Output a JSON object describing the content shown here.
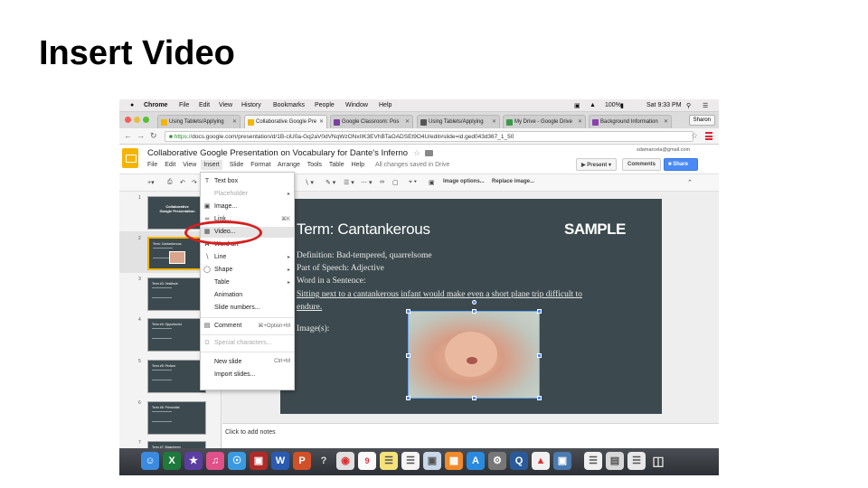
{
  "slide_title": "Insert Video",
  "mac_menu": {
    "app": "Chrome",
    "items": [
      "File",
      "Edit",
      "View",
      "History",
      "Bookmarks",
      "People",
      "Window",
      "Help"
    ],
    "battery": "100%",
    "clock": "Sat 9:33 PM"
  },
  "browser": {
    "tabs": [
      {
        "label": "Using Tablets/Applying",
        "icon": "slides-icon",
        "color": "#f4b400"
      },
      {
        "label": "Collaborative Google Pre",
        "icon": "slides-icon",
        "color": "#f4b400"
      },
      {
        "label": "Google Classroom: Pos",
        "icon": "classroom-icon",
        "color": "#7b3fa0"
      },
      {
        "label": "Using Tablets/Applying",
        "icon": "image-icon",
        "color": "#555555"
      },
      {
        "label": "My Drive - Google Drive",
        "icon": "drive-icon",
        "color": "#3a9a4a"
      },
      {
        "label": "Background Information",
        "icon": "doc-icon",
        "color": "#8a3fb0"
      }
    ],
    "user": "Sharon",
    "url_scheme": "https://",
    "url_rest": "docs.google.com/presentation/d/1B-ciU0a-Gq2aV0dVNqWzONxIIK3EVhBTaOADSEt9O4U/edit#slide=id.ged043d367_1_50"
  },
  "docs": {
    "title": "Collaborative Google Presentation on Vocabulary for Dante's Inferno",
    "menus": [
      "File",
      "Edit",
      "View",
      "Insert",
      "Slide",
      "Format",
      "Arrange",
      "Tools",
      "Table",
      "Help"
    ],
    "saved_status": "All changes saved in Drive",
    "account_email": "sdamarcela@gmail.com",
    "present_label": "Present",
    "comments_label": "Comments",
    "share_label": "Share",
    "toolbar": {
      "image_options": "Image options...",
      "replace_image": "Replace image..."
    }
  },
  "insert_menu": [
    {
      "label": "Text box",
      "icon": "textbox-icon",
      "shortcut": "",
      "submenu": false,
      "disabled": false
    },
    {
      "label": "Placeholder",
      "icon": "",
      "shortcut": "",
      "submenu": true,
      "disabled": true
    },
    {
      "label": "Image...",
      "icon": "image-icon",
      "shortcut": "",
      "submenu": false,
      "disabled": false
    },
    {
      "label": "Link...",
      "icon": "link-icon",
      "shortcut": "⌘K",
      "submenu": false,
      "disabled": false
    },
    {
      "label": "Video...",
      "icon": "video-icon",
      "shortcut": "",
      "submenu": false,
      "disabled": false
    },
    {
      "label": "Word art",
      "icon": "wordart-icon",
      "shortcut": "",
      "submenu": false,
      "disabled": false
    },
    {
      "label": "Line",
      "icon": "line-icon",
      "shortcut": "",
      "submenu": true,
      "disabled": false
    },
    {
      "label": "Shape",
      "icon": "shape-icon",
      "shortcut": "",
      "submenu": true,
      "disabled": false
    },
    {
      "label": "Table",
      "icon": "",
      "shortcut": "",
      "submenu": true,
      "disabled": false
    },
    {
      "label": "Animation",
      "icon": "",
      "shortcut": "",
      "submenu": false,
      "disabled": false
    },
    {
      "label": "Slide numbers...",
      "icon": "",
      "shortcut": "",
      "submenu": false,
      "disabled": false
    },
    {
      "label": "Comment",
      "icon": "comment-icon",
      "shortcut": "⌘+Option+M",
      "submenu": false,
      "disabled": false
    },
    {
      "label": "Special characters...",
      "icon": "omega-icon",
      "shortcut": "",
      "submenu": false,
      "disabled": true
    },
    {
      "label": "New slide",
      "icon": "",
      "shortcut": "Ctrl+M",
      "submenu": false,
      "disabled": false
    },
    {
      "label": "Import slides...",
      "icon": "",
      "shortcut": "",
      "submenu": false,
      "disabled": false
    }
  ],
  "filmstrip": {
    "numbers": [
      "1",
      "2",
      "3",
      "4",
      "5",
      "6",
      "7"
    ],
    "thumb1_title": "Collaborative Google Presentation",
    "thumb_terms": [
      "Term: Cantankerous",
      "Term #3: Vestibule",
      "Term #4: Opportunist",
      "Term #5: Pedant",
      "Term #6: Primordial",
      "Term #7: Blasphemy"
    ]
  },
  "slide": {
    "term": "Term:  Cantankerous",
    "sample": "SAMPLE",
    "definition": "Definition:  Bad-tempered, quarrelsome",
    "part_of_speech": "Part of Speech:  Adjective",
    "word_in_sentence": "Word in a Sentence:",
    "sentence_1": "Sitting next to a cantankerous infant would make even a short plane trip difficult to",
    "sentence_2": "endure.",
    "images_label": "Image(s):"
  },
  "notes_placeholder": "Click to add notes",
  "annotation_color": "#d71e1e"
}
